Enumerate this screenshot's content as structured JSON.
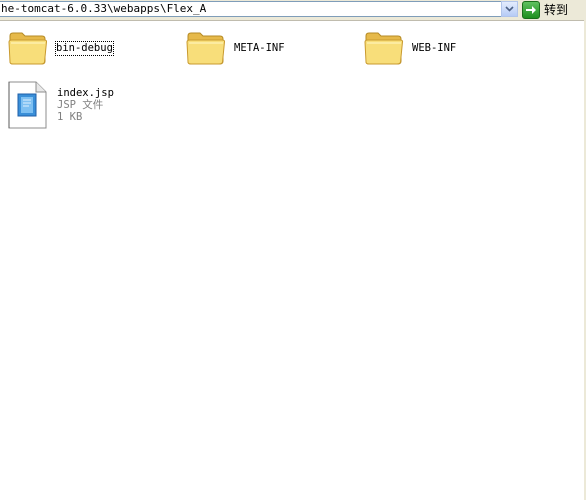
{
  "address_bar": {
    "path": "he-tomcat-6.0.33\\webapps\\Flex_A",
    "go_label": "转到"
  },
  "items": [
    {
      "name": "bin-debug",
      "type": "folder"
    },
    {
      "name": "META-INF",
      "type": "folder"
    },
    {
      "name": "WEB-INF",
      "type": "folder"
    },
    {
      "name": "index.jsp",
      "type": "file",
      "file_type": "JSP 文件",
      "size": "1 KB"
    }
  ],
  "colors": {
    "folder": "#f5d66a",
    "toolbar": "#ece9d8",
    "go_button": "#2f9a2f"
  }
}
